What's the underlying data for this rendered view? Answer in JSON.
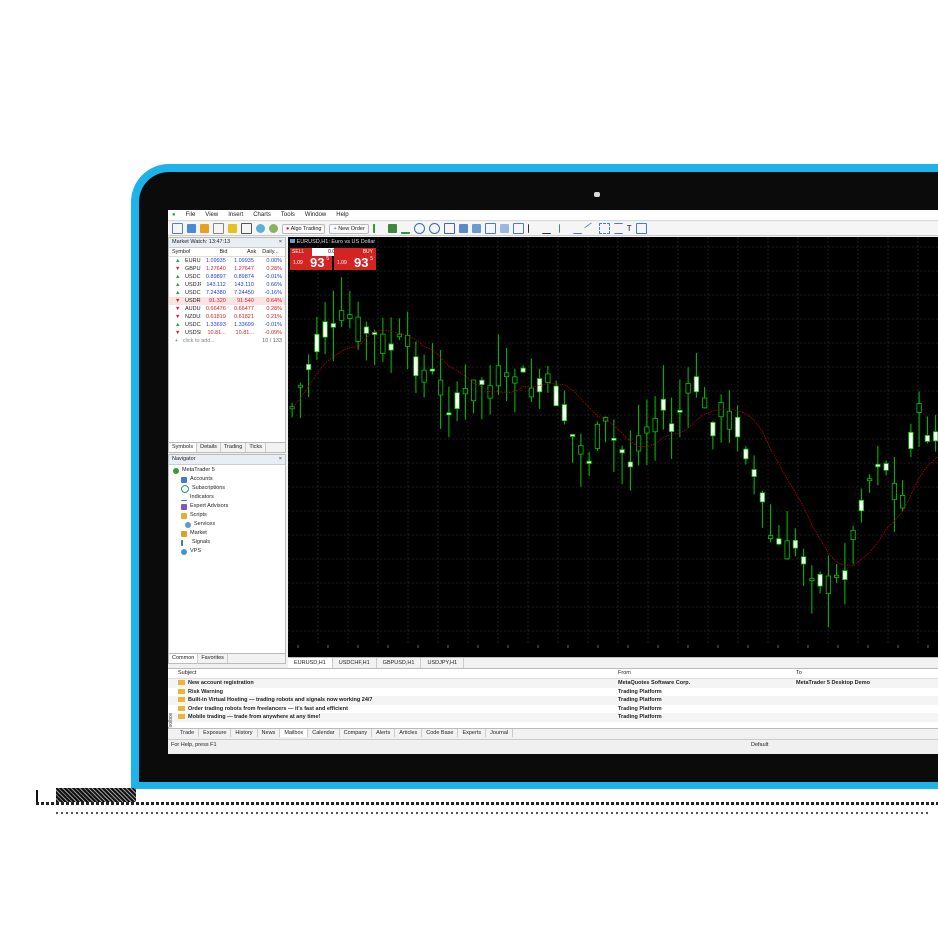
{
  "menu": [
    "File",
    "View",
    "Insert",
    "Charts",
    "Tools",
    "Window",
    "Help"
  ],
  "toolbar": {
    "algo_trading": "Algo Trading",
    "new_order": "New Order"
  },
  "market_watch": {
    "title": "Market Watch: 13:47:13",
    "columns": [
      "Symbol",
      "Bid",
      "Ask",
      "Daily..."
    ],
    "rows": [
      {
        "symbol": "EURUSD",
        "bid": "1.09935",
        "ask": "1.09935",
        "daily": "0.00%",
        "dir": "up"
      },
      {
        "symbol": "GBPUSD",
        "bid": "1.27640",
        "ask": "1.27647",
        "daily": "0.28%",
        "dir": "dn"
      },
      {
        "symbol": "USDCHF",
        "bid": "0.89897",
        "ask": "0.89874",
        "daily": "-0.01%",
        "dir": "up"
      },
      {
        "symbol": "USDJPY",
        "bid": "143.112",
        "ask": "143.110",
        "daily": "0.66%",
        "dir": "up"
      },
      {
        "symbol": "USDCNH",
        "bid": "7.24380",
        "ask": "7.24450",
        "daily": "-0.16%",
        "dir": "up"
      },
      {
        "symbol": "USDRUB",
        "bid": "91.320",
        "ask": "91.540",
        "daily": "0.64%",
        "dir": "dn"
      },
      {
        "symbol": "AUDUSD",
        "bid": "0.66476",
        "ask": "0.66477",
        "daily": "0.28%",
        "dir": "dn"
      },
      {
        "symbol": "NZDUSD",
        "bid": "0.61819",
        "ask": "0.61821",
        "daily": "0.21%",
        "dir": "dn"
      },
      {
        "symbol": "USDCAD",
        "bid": "1.33693",
        "ask": "1.33699",
        "daily": "-0.01%",
        "dir": "up"
      },
      {
        "symbol": "USDSEK",
        "bid": "10.81...",
        "ask": "10.81...",
        "daily": "-0.09%",
        "dir": "dn"
      }
    ],
    "add_hint": "click to add...",
    "count": "10 / 133",
    "tabs": [
      "Symbols",
      "Details",
      "Trading",
      "Ticks"
    ]
  },
  "navigator": {
    "title": "Navigator",
    "items": [
      "MetaTrader 5",
      "Accounts",
      "Subscriptions",
      "Indicators",
      "Expert Advisors",
      "Scripts",
      "Services",
      "Market",
      "Signals",
      "VPS"
    ],
    "tabs": [
      "Common",
      "Favorites"
    ]
  },
  "chart": {
    "title": "EURUSD,H1: Euro vs US Dollar",
    "sell_label": "SELL",
    "buy_label": "BUY",
    "lot": "0.01",
    "sell_pre": "1.09",
    "sell_big": "93",
    "sell_sup": "5",
    "buy_pre": "1.09",
    "buy_big": "93",
    "buy_sup": "5",
    "tabs": [
      "EURUSD,H1",
      "USDCHF,H1",
      "GBPUSD,H1",
      "USDJPY,H1"
    ],
    "colors": {
      "bull": "#ffffff",
      "bear": "#00c800",
      "ma": "#c00000",
      "grid": "#3a3a3a"
    }
  },
  "toolbox": {
    "columns": [
      "Subject",
      "From",
      "To"
    ],
    "rows": [
      {
        "subject": "New account registration",
        "from": "MetaQuotes Software Corp.",
        "to": "MetaTrader 5 Desktop Demo"
      },
      {
        "subject": "Risk Warning",
        "from": "Trading Platform",
        "to": ""
      },
      {
        "subject": "Built-in Virtual Hosting — trading robots and signals now working 24/7",
        "from": "Trading Platform",
        "to": ""
      },
      {
        "subject": "Order trading robots from freelancers — it's fast and efficient",
        "from": "Trading Platform",
        "to": ""
      },
      {
        "subject": "Mobile trading — trade from anywhere at any time!",
        "from": "Trading Platform",
        "to": ""
      }
    ],
    "tabs": [
      "Trade",
      "Exposure",
      "History",
      "News",
      "Mailbox",
      "Calendar",
      "Company",
      "Alerts",
      "Articles",
      "Code Base",
      "Experts",
      "Journal"
    ],
    "side_label": "Toolbox"
  },
  "status": {
    "help": "For Help, press F1",
    "profile": "Default"
  }
}
